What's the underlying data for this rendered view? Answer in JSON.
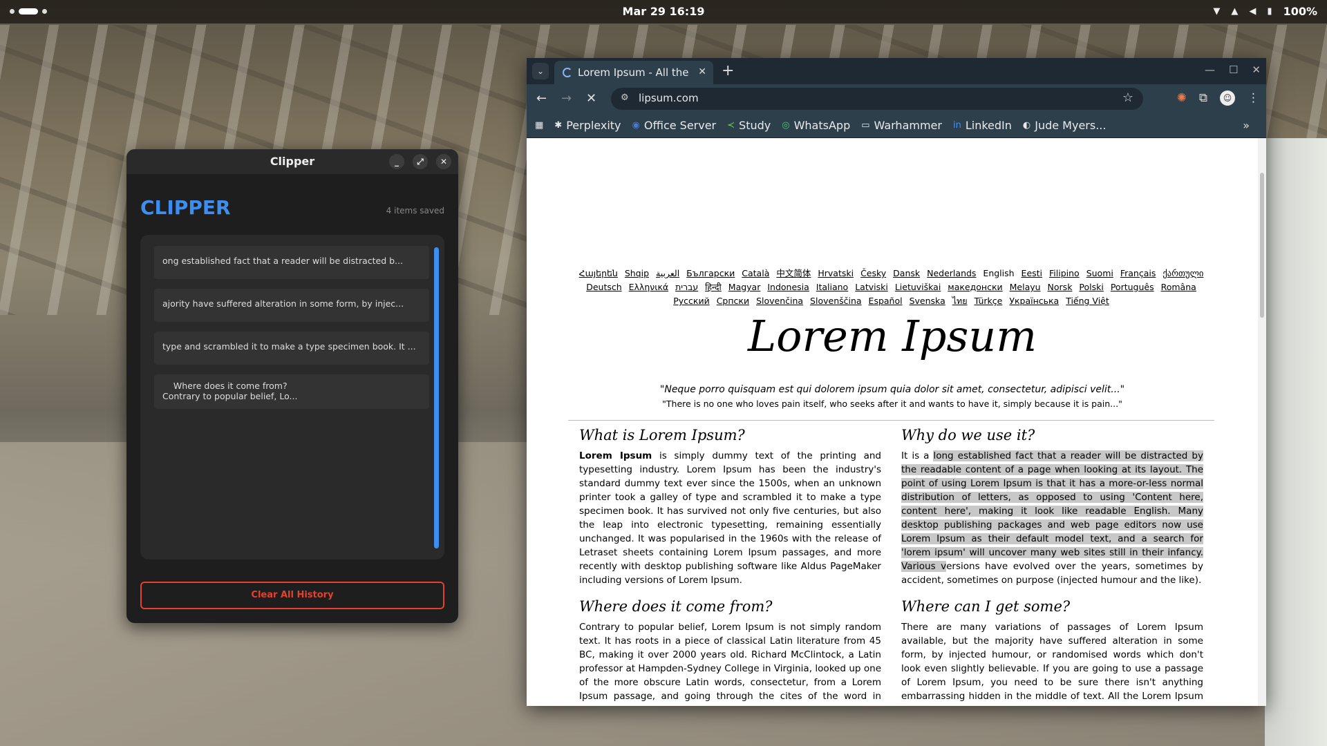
{
  "topbar": {
    "clock": "Mar 29  16:19",
    "battery": "100%"
  },
  "clipper": {
    "window_title": "Clipper",
    "app_title": "CLIPPER",
    "count": "4 items saved",
    "items": [
      "ong established fact that a reader will be distracted b...",
      "ajority have suffered alteration in some form, by injec...",
      "type and scrambled it to make a type specimen book. It ...",
      "    Where does it come from?\nContrary to popular belief, Lo..."
    ],
    "clear_label": "Clear All History",
    "accent": "#3e8ef0",
    "danger": "#e5412f"
  },
  "browser": {
    "tab_title": "Lorem Ipsum - All the",
    "url": "lipsum.com",
    "bookmarks": [
      "Perplexity",
      "Office Server",
      "Study",
      "WhatsApp",
      "Warhammer",
      "LinkedIn",
      "Jude Myers..."
    ],
    "page": {
      "languages": [
        "Հայերեն",
        "Shqip",
        "العربية",
        "Български",
        "Català",
        "中文简体",
        "Hrvatski",
        "Česky",
        "Dansk",
        "Nederlands",
        "English",
        "Eesti",
        "Filipino",
        "Suomi",
        "Français",
        "ქართული",
        "Deutsch",
        "Ελληνικά",
        "עברית",
        "हिन्दी",
        "Magyar",
        "Indonesia",
        "Italiano",
        "Latviski",
        "Lietuviškai",
        "македонски",
        "Melayu",
        "Norsk",
        "Polski",
        "Português",
        "Româna",
        "Pусский",
        "Српски",
        "Slovenčina",
        "Slovenščina",
        "Español",
        "Svenska",
        "ไทย",
        "Türkçe",
        "Українська",
        "Tiếng Việt"
      ],
      "title": "Lorem Ipsum",
      "quote_latin": "\"Neque porro quisquam est qui dolorem ipsum quia dolor sit amet, consectetur, adipisci velit...\"",
      "quote_english": "\"There is no one who loves pain itself, who seeks after it and wants to have it, simply because it is pain...\"",
      "what_heading": "What is Lorem Ipsum?",
      "what_bold": "Lorem Ipsum",
      "what_body": " is simply dummy text of the printing and typesetting industry. Lorem Ipsum has been the industry's standard dummy text ever since the 1500s, when an unknown printer took a galley of type and scrambled it to make a type specimen book. It has survived not only five centuries, but also the leap into electronic typesetting, remaining essentially unchanged. It was popularised in the 1960s with the release of Letraset sheets containing Lorem Ipsum passages, and more recently with desktop publishing software like Aldus PageMaker including versions of Lorem Ipsum.",
      "why_heading": "Why do we use it?",
      "why_pre": "It is a ",
      "why_highlight": "long established fact that a reader will be distracted by the readable content of a page when looking at its layout. The point of using Lorem Ipsum is that it has a more-or-less normal distribution of letters, as opposed to using 'Content here, content here', making it look like readable English. Many desktop publishing packages and web page editors now use Lorem Ipsum as their default model text, and a search for 'lorem ipsum' will uncover many web sites still in their infancy. Various v",
      "why_post": "ersions have evolved over the years, sometimes by accident, sometimes on purpose (injected humour and the like).",
      "where_heading": "Where does it come from?",
      "where_body": "Contrary to popular belief, Lorem Ipsum is not simply random text. It has roots in a piece of classical Latin literature from 45 BC, making it over 2000 years old. Richard McClintock, a Latin professor at Hampden-Sydney College in Virginia, looked up one of the more obscure Latin words, consectetur, from a Lorem Ipsum passage, and going through the cites of the word in classical",
      "get_heading": "Where can I get some?",
      "get_body": "There are many variations of passages of Lorem Ipsum available, but the majority have suffered alteration in some form, by injected humour, or randomised words which don't look even slightly believable. If you are going to use a passage of Lorem Ipsum, you need to be sure there isn't anything embarrassing hidden in the middle of text. All the Lorem Ipsum generators on the Internet"
    }
  }
}
